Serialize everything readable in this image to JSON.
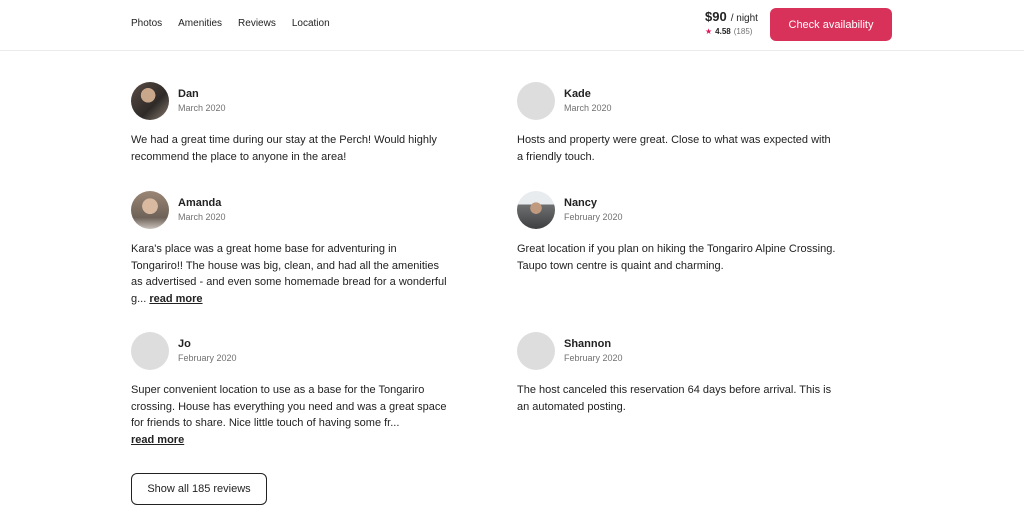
{
  "nav": {
    "items": [
      {
        "label": "Photos"
      },
      {
        "label": "Amenities"
      },
      {
        "label": "Reviews"
      },
      {
        "label": "Location"
      }
    ]
  },
  "booking": {
    "price": "$90",
    "per_night": "/ night",
    "rating": "4.58",
    "review_count": "(185)",
    "cta_label": "Check availability",
    "star_color": "#e1165a",
    "cta_color": "#d9325a"
  },
  "reviews": [
    {
      "name": "Dan",
      "date": "March 2020",
      "avatar": "photo",
      "text": "We had a great time during our stay at the Perch! Would highly recommend the place to anyone in the area!",
      "read_more": ""
    },
    {
      "name": "Kade",
      "date": "March 2020",
      "avatar": "placeholder",
      "text": "Hosts and property were great. Close to what was expected with a friendly touch.",
      "read_more": ""
    },
    {
      "name": "Amanda",
      "date": "March 2020",
      "avatar": "photo",
      "text": "Kara's place was a great home base for adventuring in Tongariro!! The house was big, clean, and had all the amenities as advertised - and even some homemade bread for a wonderful g... ",
      "read_more": "read more"
    },
    {
      "name": "Nancy",
      "date": "February 2020",
      "avatar": "photo",
      "text": "Great location if you plan on hiking the Tongariro Alpine Crossing. Taupo town centre is quaint and charming.",
      "read_more": ""
    },
    {
      "name": "Jo",
      "date": "February 2020",
      "avatar": "placeholder",
      "text": "Super convenient location to use as a base for the Tongariro crossing. House has everything you need and was a great space for friends to share. Nice little touch of having some fr...",
      "read_more": "read more"
    },
    {
      "name": "Shannon",
      "date": "February 2020",
      "avatar": "placeholder",
      "text": "The host canceled this reservation 64 days before arrival. This is an automated posting.",
      "read_more": ""
    }
  ],
  "show_all_label": "Show all 185 reviews"
}
